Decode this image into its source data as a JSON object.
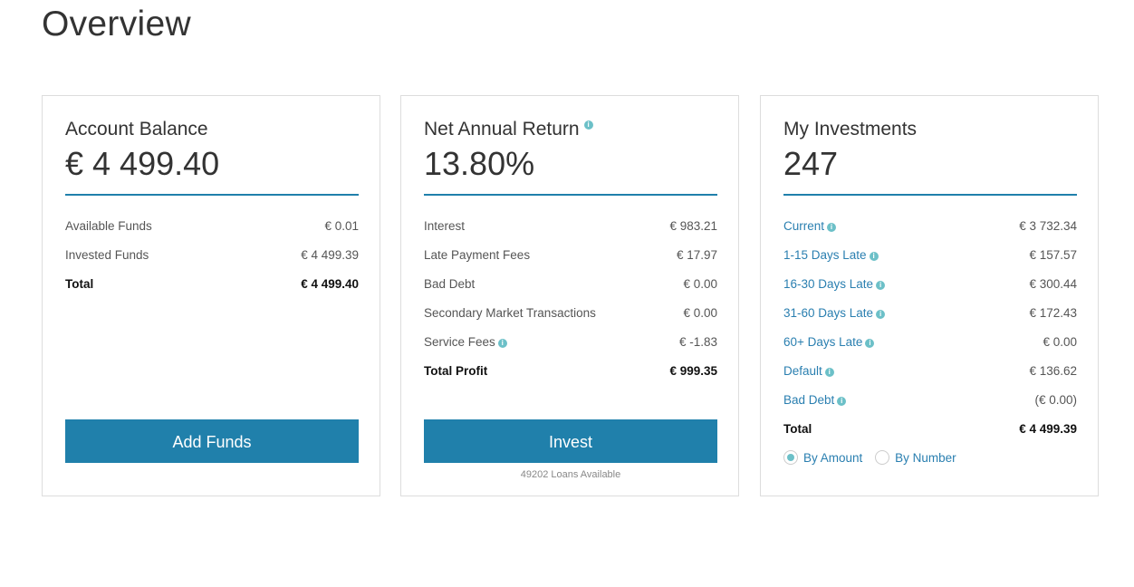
{
  "page": {
    "title": "Overview"
  },
  "account_balance": {
    "heading": "Account Balance",
    "value": "€ 4 499.40",
    "rows": [
      {
        "label": "Available Funds",
        "value": "€ 0.01"
      },
      {
        "label": "Invested Funds",
        "value": "€ 4 499.39"
      }
    ],
    "total": {
      "label": "Total",
      "value": "€ 4 499.40"
    },
    "button_label": "Add Funds"
  },
  "net_annual_return": {
    "heading": "Net Annual Return",
    "heading_icon": "info-icon",
    "value": "13.80%",
    "rows": [
      {
        "label": "Interest",
        "value": "€ 983.21"
      },
      {
        "label": "Late Payment Fees",
        "value": "€ 17.97"
      },
      {
        "label": "Bad Debt",
        "value": "€ 0.00"
      },
      {
        "label": "Secondary Market Transactions",
        "value": "€ 0.00"
      },
      {
        "label": "Service Fees",
        "value": "€ -1.83",
        "icon": "info-icon"
      }
    ],
    "total": {
      "label": "Total Profit",
      "value": "€ 999.35"
    },
    "button_label": "Invest",
    "loans_available": "49202 Loans Available"
  },
  "my_investments": {
    "heading": "My Investments",
    "value": "247",
    "rows": [
      {
        "label": "Current",
        "value": "€ 3 732.34",
        "icon": "info-icon"
      },
      {
        "label": "1-15 Days Late",
        "value": "€ 157.57",
        "icon": "info-icon"
      },
      {
        "label": "16-30 Days Late",
        "value": "€ 300.44",
        "icon": "info-icon"
      },
      {
        "label": "31-60 Days Late",
        "value": "€ 172.43",
        "icon": "info-icon"
      },
      {
        "label": "60+ Days Late",
        "value": "€ 0.00",
        "icon": "info-icon"
      },
      {
        "label": "Default",
        "value": "€ 136.62",
        "icon": "info-icon"
      },
      {
        "label": "Bad Debt",
        "value": "(€ 0.00)",
        "icon": "info-icon"
      }
    ],
    "total": {
      "label": "Total",
      "value": "€ 4 499.39"
    },
    "view_options": [
      {
        "label": "By Amount",
        "selected": true
      },
      {
        "label": "By Number",
        "selected": false
      }
    ]
  },
  "colors": {
    "accent": "#2080ab",
    "link": "#2a7fb0",
    "info_icon": "#6cc0c8",
    "card_border": "#dddddd"
  }
}
